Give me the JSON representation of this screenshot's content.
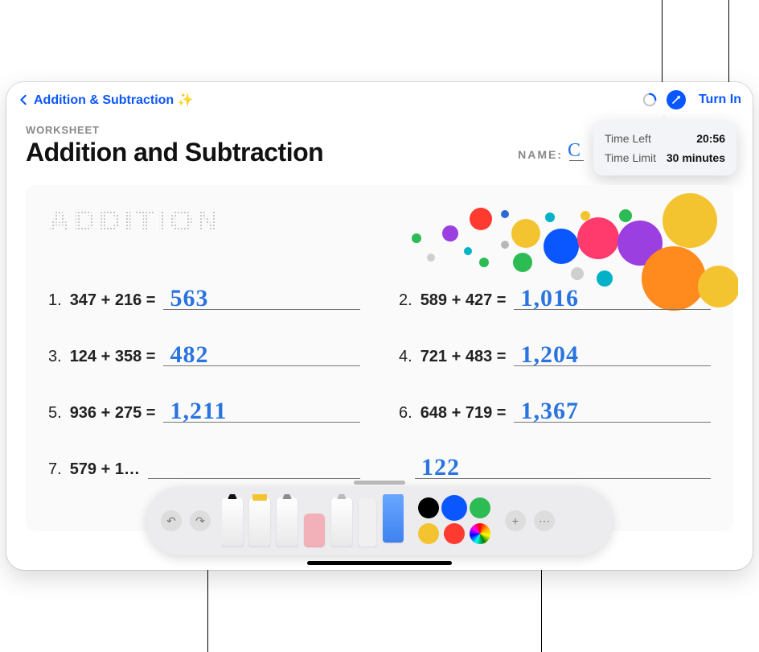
{
  "nav": {
    "title": "Addition & Subtraction ✨",
    "turn_in": "Turn In"
  },
  "time_popover": {
    "time_left_label": "Time Left",
    "time_left_value": "20:56",
    "time_limit_label": "Time Limit",
    "time_limit_value": "30 minutes"
  },
  "page": {
    "eyebrow": "WORKSHEET",
    "title": "Addition and Subtraction",
    "name_label": "NAME:",
    "name_written": "C"
  },
  "section": {
    "heading": "ADDITION"
  },
  "problems": [
    {
      "n": "1.",
      "expr": "347 + 216 =",
      "answer": "563"
    },
    {
      "n": "2.",
      "expr": "589 + 427 =",
      "answer": "1,016"
    },
    {
      "n": "3.",
      "expr": "124 + 358 =",
      "answer": "482"
    },
    {
      "n": "4.",
      "expr": "721 + 483 =",
      "answer": "1,204"
    },
    {
      "n": "5.",
      "expr": "936 + 275 =",
      "answer": "1,211"
    },
    {
      "n": "6.",
      "expr": "648 + 719 =",
      "answer": "1,367"
    },
    {
      "n": "7.",
      "expr": "579 + 1…",
      "answer": ""
    },
    {
      "n": "",
      "expr": "",
      "answer": "122"
    }
  ],
  "toolbar": {
    "undo": "↶",
    "redo": "↷",
    "add": "+",
    "more": "⋯"
  },
  "colors": {
    "black": "#000000",
    "blue": "#0a57ff",
    "green": "#2dbb54",
    "yellow": "#f4c430",
    "red": "#ff3b30"
  }
}
